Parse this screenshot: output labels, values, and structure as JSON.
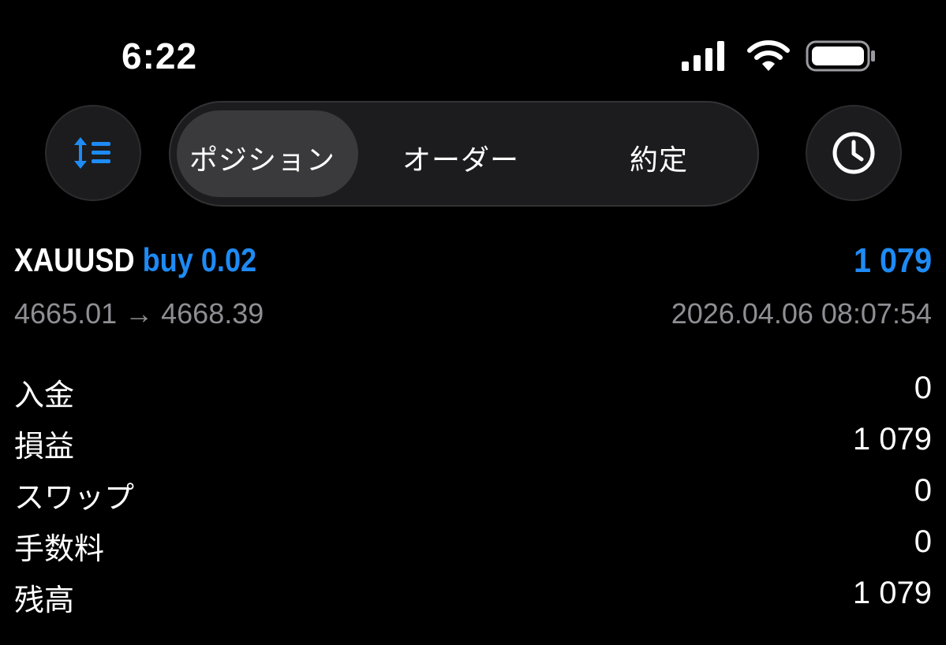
{
  "status_bar": {
    "time": "6:22",
    "icons": [
      "signal-icon",
      "wifi-icon",
      "battery-icon"
    ]
  },
  "toolbar": {
    "sort_icon": "sort-list-icon",
    "history_icon": "clock-icon",
    "tabs": [
      {
        "label": "ポジション",
        "active": true
      },
      {
        "label": "オーダー",
        "active": false
      },
      {
        "label": "約定",
        "active": false
      }
    ]
  },
  "position": {
    "symbol": "XAUUSD",
    "side": "buy 0.02",
    "profit": "1 079",
    "prices": "4665.01 → 4668.39",
    "time": "2026.04.06 08:07:54"
  },
  "summary": [
    {
      "label": "入金",
      "value": "0"
    },
    {
      "label": "損益",
      "value": "1 079"
    },
    {
      "label": "スワップ",
      "value": "0"
    },
    {
      "label": "手数料",
      "value": "0"
    },
    {
      "label": "残高",
      "value": "1 079"
    }
  ],
  "colors": {
    "accent": "#1e8bf5",
    "background": "#000000",
    "secondary_text": "#8e8e93"
  }
}
